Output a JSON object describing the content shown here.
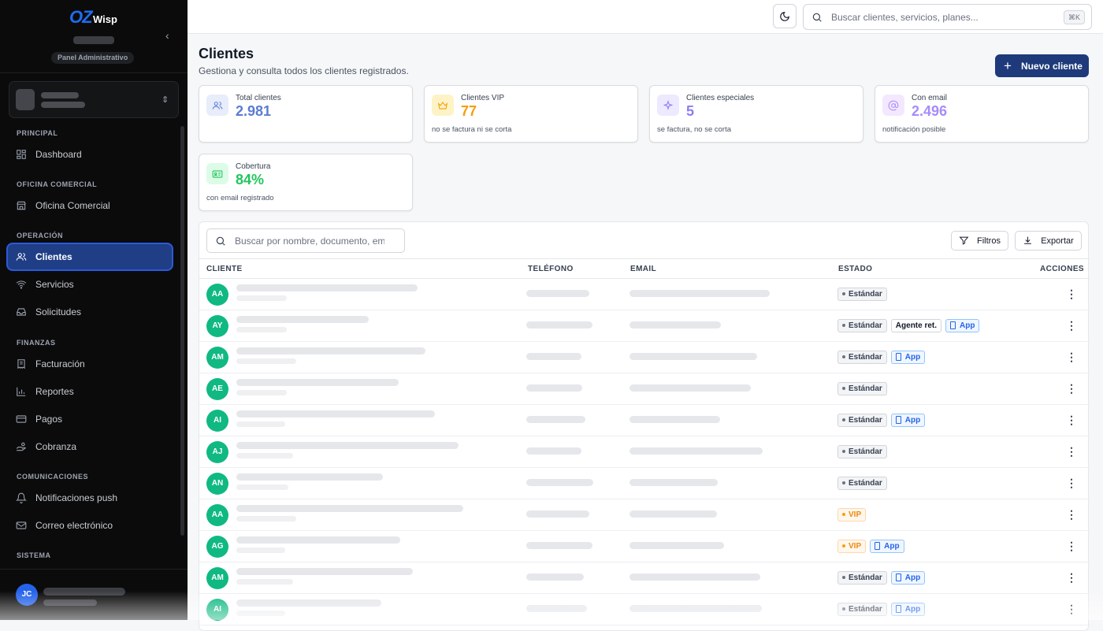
{
  "sidebar": {
    "logo_oz": "OZ",
    "logo_wisp": "Wisp",
    "panel_label": "Panel Administrativo",
    "sections": [
      {
        "title": "PRINCIPAL",
        "items": [
          {
            "label": "Dashboard",
            "icon": "grid-icon"
          }
        ]
      },
      {
        "title": "OFICINA COMERCIAL",
        "items": [
          {
            "label": "Oficina Comercial",
            "icon": "store-icon"
          }
        ]
      },
      {
        "title": "OPERACIÓN",
        "items": [
          {
            "label": "Clientes",
            "icon": "users-icon",
            "active": true
          },
          {
            "label": "Servicios",
            "icon": "wifi-icon"
          },
          {
            "label": "Solicitudes",
            "icon": "inbox-icon"
          }
        ]
      },
      {
        "title": "FINANZAS",
        "items": [
          {
            "label": "Facturación",
            "icon": "receipt-icon"
          },
          {
            "label": "Reportes",
            "icon": "bar-chart-icon"
          },
          {
            "label": "Pagos",
            "icon": "card-icon"
          },
          {
            "label": "Cobranza",
            "icon": "hand-coins-icon"
          }
        ]
      },
      {
        "title": "COMUNICACIONES",
        "items": [
          {
            "label": "Notificaciones push",
            "icon": "bell-icon"
          },
          {
            "label": "Correo electrónico",
            "icon": "mail-icon"
          }
        ]
      },
      {
        "title": "SISTEMA",
        "items": []
      }
    ],
    "user_initials": "JC"
  },
  "topbar": {
    "search_placeholder": "Buscar clientes, servicios, planes...",
    "shortcut": "⌘K"
  },
  "page": {
    "title": "Clientes",
    "subtitle": "Gestiona y consulta todos los clientes registrados.",
    "new_button": "Nuevo cliente"
  },
  "stats": [
    {
      "label": "Total clientes",
      "value": "2.981",
      "note": "",
      "color": "#5b7bd5",
      "icon": "users-icon"
    },
    {
      "label": "Clientes VIP",
      "value": "77",
      "note": "no se factura ni se corta",
      "color": "#f59e0b",
      "icon": "crown-icon"
    },
    {
      "label": "Clientes especiales",
      "value": "5",
      "note": "se factura, no se corta",
      "color": "#8b7cf6",
      "icon": "sparkles-icon"
    },
    {
      "label": "Con email",
      "value": "2.496",
      "note": "notificación posible",
      "color": "#a78bfa",
      "icon": "at-icon"
    },
    {
      "label": "Cobertura",
      "value": "84%",
      "note": "con email registrado",
      "color": "#22c55e",
      "icon": "id-card-icon"
    }
  ],
  "table": {
    "search_placeholder": "Buscar por nombre, documento, email",
    "filters_label": "Filtros",
    "export_label": "Exportar",
    "columns": [
      "CLIENTE",
      "TELÉFONO",
      "EMAIL",
      "ESTADO",
      "ACCIONES"
    ],
    "rows": [
      {
        "initials": "AA",
        "badges": [
          "Estándar"
        ]
      },
      {
        "initials": "AY",
        "badges": [
          "Estándar",
          "Agente ret.",
          "App"
        ]
      },
      {
        "initials": "AM",
        "badges": [
          "Estándar",
          "App"
        ]
      },
      {
        "initials": "AE",
        "badges": [
          "Estándar"
        ]
      },
      {
        "initials": "AI",
        "badges": [
          "Estándar",
          "App"
        ]
      },
      {
        "initials": "AJ",
        "badges": [
          "Estándar"
        ]
      },
      {
        "initials": "AN",
        "badges": [
          "Estándar"
        ]
      },
      {
        "initials": "AA",
        "badges": [
          "VIP"
        ]
      },
      {
        "initials": "AG",
        "badges": [
          "VIP",
          "App"
        ]
      },
      {
        "initials": "AM",
        "badges": [
          "Estándar",
          "App"
        ]
      },
      {
        "initials": "AI",
        "badges": [
          "Estándar",
          "App"
        ]
      }
    ],
    "actions_icon": "more-vertical-icon"
  }
}
